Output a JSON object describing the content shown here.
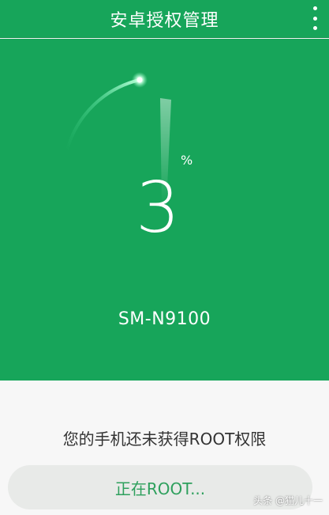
{
  "app": {
    "title": "安卓授权管理"
  },
  "progress": {
    "value": "3",
    "unit": "%",
    "fraction": 0.03
  },
  "device": {
    "model": "SM-N9100"
  },
  "status": {
    "message": "您的手机还未获得ROOT权限",
    "button_label": "正在ROOT..."
  },
  "watermark": {
    "text": "头条 @猫儿十一"
  },
  "colors": {
    "primary_green": "#17a55a",
    "button_text": "#2ea05d",
    "panel_bg": "#f7f7f7"
  },
  "icons": {
    "menu": "vertical-ellipsis-icon",
    "progress_head": "glow-dot-icon"
  }
}
